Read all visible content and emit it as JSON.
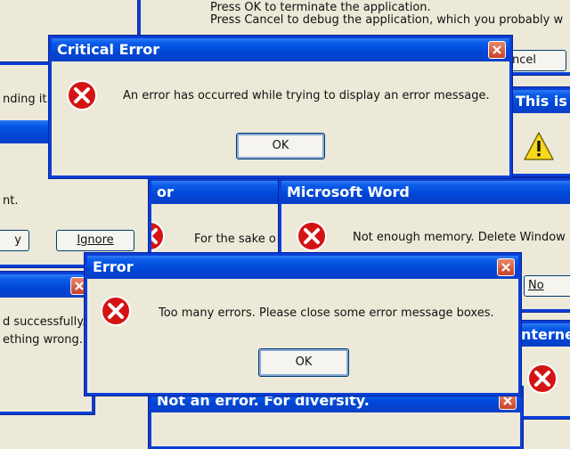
{
  "top_dialog": {
    "line1": "Press OK to terminate the application.",
    "line2": "Press Cancel to debug the application, which you probably w",
    "cancel_label": "ncel"
  },
  "left_mid": {
    "text1": "nding it.",
    "text2": "nt.",
    "retry_label": "y",
    "ignore_label": "Ignore"
  },
  "left_bottom": {
    "text1": "d successfully.",
    "text2": "ething wrong."
  },
  "right_upper": {
    "title": "This is"
  },
  "partial_error": {
    "title": "or",
    "text": "For the sake o"
  },
  "critical_error": {
    "title": "Critical Error",
    "message": "An error has occurred while trying to display an error message.",
    "ok_label": "OK"
  },
  "ms_word": {
    "title": "Microsoft Word",
    "message": "Not enough memory. Delete Window",
    "no_label": "No"
  },
  "internet": {
    "title": "nterne"
  },
  "error_main": {
    "title": "Error",
    "message": "Too many errors. Please close some error message boxes.",
    "ok_label": "OK"
  },
  "not_error": {
    "title": "Not an error. For diversity."
  },
  "icons": {
    "error": "error-icon",
    "warning": "warning-icon",
    "close": "close-icon"
  }
}
